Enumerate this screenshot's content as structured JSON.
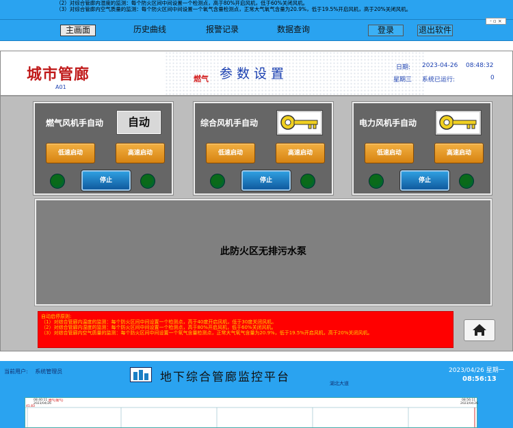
{
  "top_strip": {
    "lines": [
      "（2）对综合管廊内湿度的监测：每个防火区间中间设置一个检测点，高于80%开启风机，低于60%关闭风机。",
      "（3）对综合管廊内空气质量的监测：每个防火区间中间设置一个氧气含量检测点，正常大气氧气含量为20.9%，低于19.5%开启风机，高于20%关闭风机。"
    ]
  },
  "nav": {
    "items": [
      "主画面",
      "历史曲线",
      "报警记录",
      "数据查询",
      "登录",
      "退出软件"
    ]
  },
  "header": {
    "city_title": "城市管廊",
    "code": "A01",
    "gas_tag": "燃气",
    "page_title": "参数设置",
    "date_label": "日期:",
    "date_value": "2023-04-26",
    "time_value": "08:48:32",
    "weekday": "星期三",
    "runtime_label": "系统已运行:",
    "runtime_value": "0"
  },
  "cards": [
    {
      "title": "燃气风机手自动",
      "toggle_label": "自动",
      "low_label": "低速启动",
      "high_label": "高速启动",
      "stop_label": "停止"
    },
    {
      "title": "综合风机手自动",
      "low_label": "低速启动",
      "high_label": "高速启动",
      "stop_label": "停止"
    },
    {
      "title": "电力风机手自动",
      "low_label": "低速启动",
      "high_label": "高速启动",
      "stop_label": "停止"
    }
  ],
  "pump_message": "此防火区无排污水泵",
  "notice": {
    "lines": [
      "自动启停原则:",
      "（1）对综合管廊内温度的监测：每个防火区间中间设置一个检测点，高于40度开启风机，低于30度关闭风机。",
      "（2）对综合管廊内湿度的监测：每个防火区间中间设置一个检测点，高于80%开启风机，低于60%关闭风机。",
      "（3）对综合管廊内空气质量的监测：每个防火区间中间设置一个氧气含量检测点，正常大气氧气含量为20.9%，低于19.5%开启风机，高于20%关闭风机。"
    ]
  },
  "footer": {
    "user_label": "当前用户:",
    "user_name": "系统管理员",
    "platform_title": "地下综合管廊监控平台",
    "place": "湖北大道",
    "date_week": "2023/04/26 星期一",
    "time": "08:56:13"
  },
  "chart": {
    "left_time": "08:40:11",
    "legend": "燃气(氧气)",
    "left_date": "2023/04/26",
    "ytick": "41.83",
    "right_time": "08:56:11",
    "right_date": "2023/04/26"
  },
  "colors": {
    "accent": "#2aa3f0",
    "alarm": "#ff0000"
  }
}
